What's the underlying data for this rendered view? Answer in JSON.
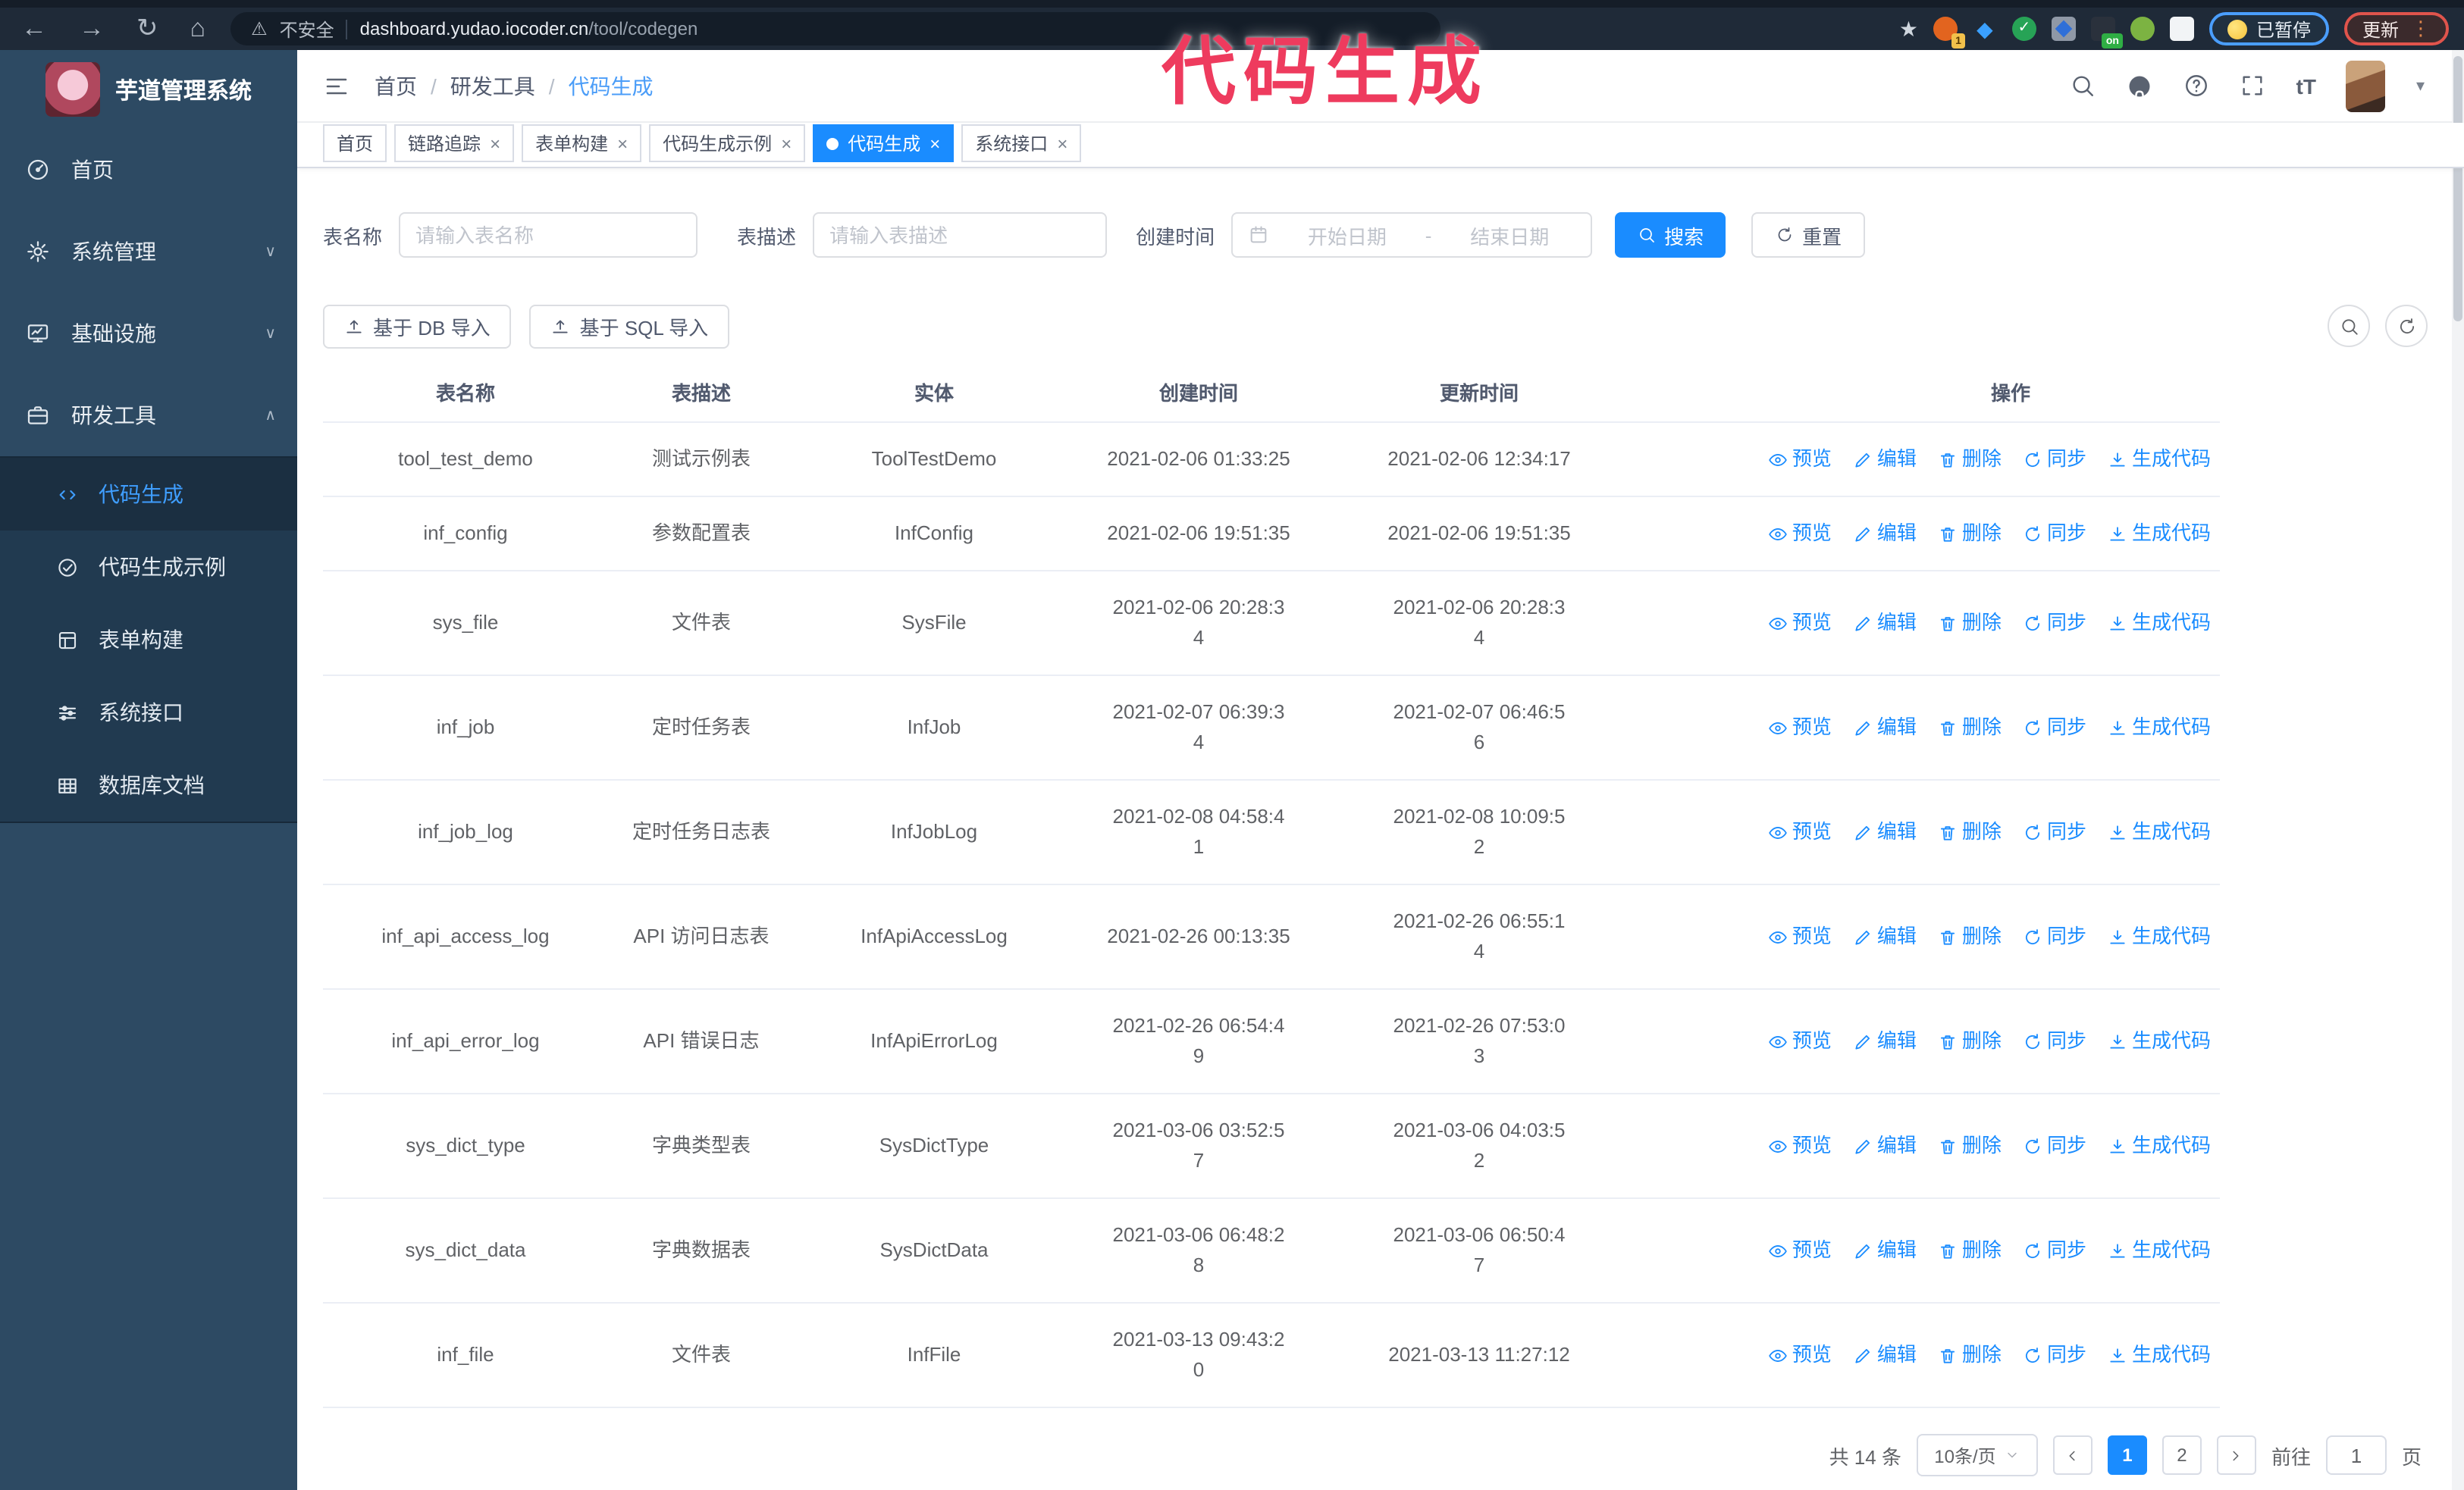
{
  "browser": {
    "security_label": "不安全",
    "url_host": "dashboard.yudao.iocoder.cn",
    "url_path": "/tool/codegen",
    "paused_badge": "已暂停",
    "update_button": "更新",
    "ext_badge_1": "1",
    "ext_badge_on": "on"
  },
  "glyphs": {
    "back": "←",
    "forward": "→",
    "reload": "↻",
    "home": "⌂",
    "warning": "⚠",
    "star": "★",
    "kebab": "⋮",
    "caret": "▾",
    "close": "×",
    "diamond": "◆",
    "check": "✓",
    "chev_down": "∨",
    "chev_up": "∧"
  },
  "annotation": {
    "text": "代码生成",
    "color": "#ee3b5e"
  },
  "sidebar": {
    "title": "芋道管理系统",
    "items": [
      {
        "label": "首页"
      },
      {
        "label": "系统管理"
      },
      {
        "label": "基础设施"
      },
      {
        "label": "研发工具"
      }
    ],
    "submenu": [
      {
        "label": "代码生成"
      },
      {
        "label": "代码生成示例"
      },
      {
        "label": "表单构建"
      },
      {
        "label": "系统接口"
      },
      {
        "label": "数据库文档"
      }
    ]
  },
  "header": {
    "breadcrumb": [
      "首页",
      "研发工具",
      "代码生成"
    ],
    "separator": "/"
  },
  "tabs": [
    {
      "label": "首页"
    },
    {
      "label": "链路追踪"
    },
    {
      "label": "表单构建"
    },
    {
      "label": "代码生成示例"
    },
    {
      "label": "代码生成"
    },
    {
      "label": "系统接口"
    }
  ],
  "filters": {
    "table_name_label": "表名称",
    "table_name_ph": "请输入表名称",
    "table_desc_label": "表描述",
    "table_desc_ph": "请输入表描述",
    "create_time_label": "创建时间",
    "date_start_ph": "开始日期",
    "date_separator": "-",
    "date_end_ph": "结束日期",
    "search_label": "搜索",
    "reset_label": "重置"
  },
  "toolbar": {
    "import_db_label": "基于 DB 导入",
    "import_sql_label": "基于 SQL 导入"
  },
  "table": {
    "columns": [
      "表名称",
      "表描述",
      "实体",
      "创建时间",
      "更新时间",
      "操作"
    ],
    "ops": {
      "preview": "预览",
      "edit": "编辑",
      "delete": "删除",
      "sync": "同步",
      "generate": "生成代码"
    },
    "rows": [
      {
        "name": "tool_test_demo",
        "desc": "测试示例表",
        "entity": "ToolTestDemo",
        "created": "2021-02-06 01:33:25",
        "updated": "2021-02-06 12:34:17"
      },
      {
        "name": "inf_config",
        "desc": "参数配置表",
        "entity": "InfConfig",
        "created": "2021-02-06 19:51:35",
        "updated": "2021-02-06 19:51:35"
      },
      {
        "name": "sys_file",
        "desc": "文件表",
        "entity": "SysFile",
        "created": "2021-02-06 20:28:3\n4",
        "updated": "2021-02-06 20:28:3\n4"
      },
      {
        "name": "inf_job",
        "desc": "定时任务表",
        "entity": "InfJob",
        "created": "2021-02-07 06:39:3\n4",
        "updated": "2021-02-07 06:46:5\n6"
      },
      {
        "name": "inf_job_log",
        "desc": "定时任务日志表",
        "entity": "InfJobLog",
        "created": "2021-02-08 04:58:4\n1",
        "updated": "2021-02-08 10:09:5\n2"
      },
      {
        "name": "inf_api_access_log",
        "desc": "API 访问日志表",
        "entity": "InfApiAccessLog",
        "created": "2021-02-26 00:13:35",
        "updated": "2021-02-26 06:55:1\n4"
      },
      {
        "name": "inf_api_error_log",
        "desc": "API 错误日志",
        "entity": "InfApiErrorLog",
        "created": "2021-02-26 06:54:4\n9",
        "updated": "2021-02-26 07:53:0\n3"
      },
      {
        "name": "sys_dict_type",
        "desc": "字典类型表",
        "entity": "SysDictType",
        "created": "2021-03-06 03:52:5\n7",
        "updated": "2021-03-06 04:03:5\n2"
      },
      {
        "name": "sys_dict_data",
        "desc": "字典数据表",
        "entity": "SysDictData",
        "created": "2021-03-06 06:48:2\n8",
        "updated": "2021-03-06 06:50:4\n7"
      },
      {
        "name": "inf_file",
        "desc": "文件表",
        "entity": "InfFile",
        "created": "2021-03-13 09:43:2\n0",
        "updated": "2021-03-13 11:27:12"
      }
    ]
  },
  "pagination": {
    "total": "共 14 条",
    "page_size": "10条/页",
    "pages": [
      "1",
      "2"
    ],
    "goto_label": "前往",
    "goto_value": "1",
    "page_suffix": "页"
  }
}
